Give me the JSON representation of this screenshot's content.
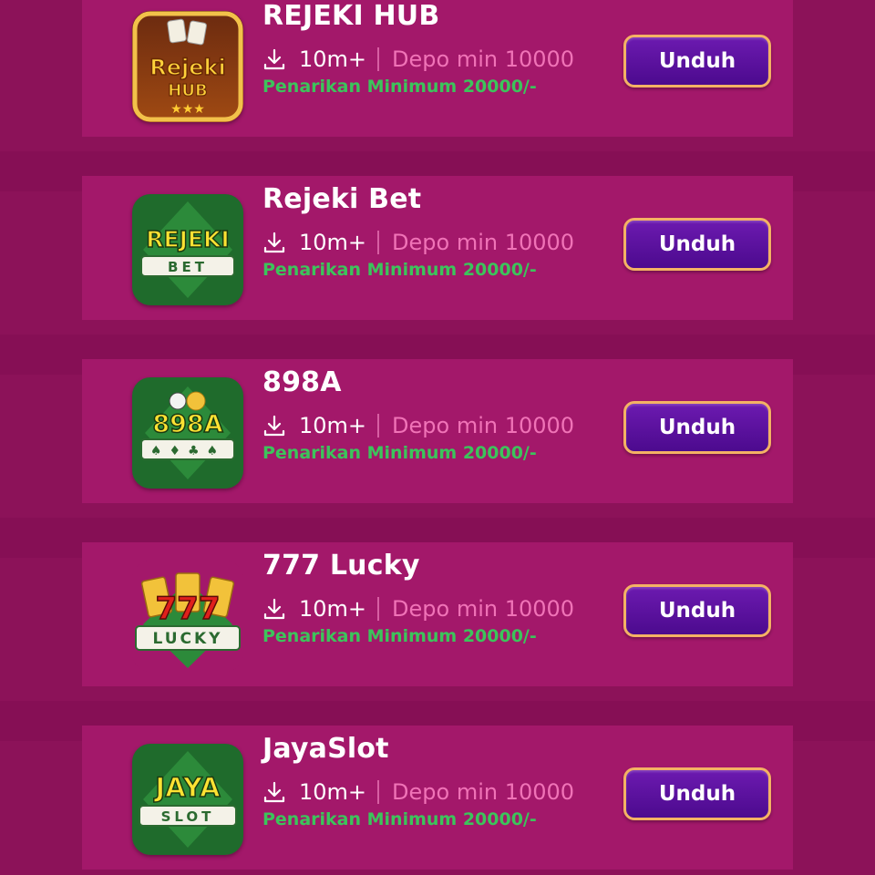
{
  "apps": [
    {
      "name": "REJEKI HUB",
      "icon": "rejeki-hub-logo",
      "icon_text": [
        "Rejeki",
        "HUB"
      ],
      "downloads": "10m+",
      "depo": "Depo min 10000",
      "withdraw": "Penarikan Minimum 20000/-",
      "button": "Unduh"
    },
    {
      "name": "Rejeki Bet",
      "icon": "rejeki-bet-logo",
      "icon_text": [
        "REJEKI",
        "BET"
      ],
      "downloads": "10m+",
      "depo": "Depo min 10000",
      "withdraw": "Penarikan Minimum 20000/-",
      "button": "Unduh"
    },
    {
      "name": "898A",
      "icon": "898a-logo",
      "icon_text": [
        "898A"
      ],
      "downloads": "10m+",
      "depo": "Depo min 10000",
      "withdraw": "Penarikan Minimum 20000/-",
      "button": "Unduh"
    },
    {
      "name": "777 Lucky",
      "icon": "777-lucky-logo",
      "icon_text": [
        "777",
        "LUCKY"
      ],
      "downloads": "10m+",
      "depo": "Depo min 10000",
      "withdraw": "Penarikan Minimum 20000/-",
      "button": "Unduh"
    },
    {
      "name": "JayaSlot",
      "icon": "jaya-slot-logo",
      "icon_text": [
        "JAYA",
        "SLOT"
      ],
      "downloads": "10m+",
      "depo": "Depo min 10000",
      "withdraw": "Penarikan Minimum 20000/-",
      "button": "Unduh"
    }
  ],
  "colors": {
    "background": "#8c1259",
    "card": "#a3186a",
    "title": "#ffffff",
    "depo_text": "#f073b7",
    "withdraw_text": "#3cc45b",
    "button_fill": "#5a1099",
    "button_border": "#f4b264"
  }
}
